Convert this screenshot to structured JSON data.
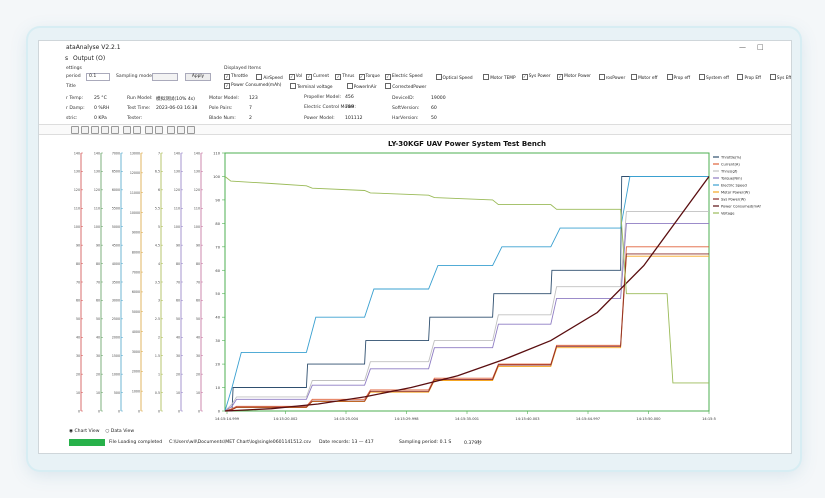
{
  "window": {
    "title": "ataAnalyse V2.2.1",
    "close_icon": "close-icon",
    "max_icon": "maximize-icon"
  },
  "menu": {
    "item1": "s",
    "item2": "Output (O)"
  },
  "settings": {
    "section": "ettings",
    "period_label": "period",
    "period_value": "0.1",
    "sampling_mode_label": "Sampling mode",
    "apply_label": "Apply",
    "title_label": "Title"
  },
  "displayed_items": {
    "header": "Displayed Items",
    "row1": [
      {
        "label": "Throttle",
        "checked": true
      },
      {
        "label": "AirSpeed",
        "checked": false
      },
      {
        "label": "Vol",
        "checked": true
      },
      {
        "label": "Current",
        "checked": true
      },
      {
        "label": "Thrus",
        "checked": true
      },
      {
        "label": "Torque",
        "checked": true
      },
      {
        "label": "Electric Speed",
        "checked": true
      },
      {
        "label": "Optical Speed",
        "checked": false
      },
      {
        "label": "Motor TEMP",
        "checked": false
      },
      {
        "label": "Sys Power",
        "checked": true
      },
      {
        "label": "Motor Power",
        "checked": true
      },
      {
        "label": "rosPower",
        "checked": false
      },
      {
        "label": "Motor eff",
        "checked": false
      },
      {
        "label": "Prop eff",
        "checked": false
      },
      {
        "label": "System eff",
        "checked": false
      },
      {
        "label": "Prop Eff",
        "checked": false
      },
      {
        "label": "Sys Eff",
        "checked": false
      }
    ],
    "row2": [
      {
        "label": "Power Consumed(mAh)",
        "checked": true
      },
      {
        "label": "Terminal voltage",
        "checked": false
      },
      {
        "label": "PowerInAir",
        "checked": false
      },
      {
        "label": "CorrectedPower",
        "checked": false
      }
    ]
  },
  "info": {
    "temp_label": "r Temp:",
    "temp_value": "25 °C",
    "damp_label": "r Damp:",
    "damp_value": "0 %RH",
    "atmos_label": "stric:",
    "atmos_value": "0 KPa",
    "run_model_label": "Run Model:",
    "run_model_value": "模拟测试(10% 4s)",
    "test_time_label": "Test Time:",
    "test_time_value": "2023-06-03 16:38",
    "tester_label": "Tester:",
    "tester_value": "",
    "motor_model_label": "Motor Model:",
    "motor_model_value": "123",
    "pole_pairs_label": "Pole Pairs:",
    "pole_pairs_value": "7",
    "blade_num_label": "Blade Num:",
    "blade_num_value": "2",
    "propeller_label": "Propeller Model:",
    "propeller_value": "456",
    "esc_label": "Electric Control Model:",
    "esc_value": "789",
    "power_model_label": "Power Model:",
    "power_model_value": "101112",
    "device_id_label": "DeviceID:",
    "device_id_value": "19000",
    "soft_label": "SoftVersion:",
    "soft_value": "60",
    "hard_label": "HarVersion:",
    "hard_value": "50"
  },
  "views": {
    "chart": "Chart View",
    "data": "Data View"
  },
  "status": {
    "file_loaded": "File Loading completed",
    "path": "C:\\Users\\wll\\Documents\\MET Chart\\log\\single0601141512.csv",
    "records": "Date records: 13 — 417",
    "period": "Sampling period: 0.1 S",
    "elapsed": "0.379秒",
    "progress": 1.0
  },
  "chart_data": {
    "type": "line",
    "title": "LY-30KGF UAV Power System Test Bench",
    "x_ticks": [
      "14:15:14.999",
      "14:15:20.002",
      "14:15:25.004",
      "14:15:29.998",
      "14:15:35.001",
      "14:15:40.003",
      "14:15:44.997",
      "14:15:50.000",
      "14:15:5"
    ],
    "xlim": [
      0,
      416
    ],
    "ylim": [
      0,
      110
    ],
    "y_ticks_main": [
      0,
      10,
      20,
      30,
      40,
      50,
      60,
      70,
      80,
      90,
      100,
      110
    ],
    "left_axes": [
      {
        "color": "#d04848",
        "ticks": [
          "0",
          "10",
          "20",
          "30",
          "40",
          "50",
          "60",
          "70",
          "80",
          "90",
          "100",
          "110",
          "120",
          "130",
          "140"
        ]
      },
      {
        "color": "#5b9b5b",
        "ticks": [
          "0",
          "10",
          "20",
          "30",
          "40",
          "50",
          "60",
          "70",
          "80",
          "90",
          "100",
          "110",
          "120",
          "130",
          "140"
        ]
      },
      {
        "color": "#4aa3c8",
        "ticks": [
          "0",
          "500",
          "1000",
          "1500",
          "2000",
          "2500",
          "3000",
          "3500",
          "4000",
          "4500",
          "5000",
          "5500",
          "6000",
          "6500",
          "7000"
        ]
      },
      {
        "color": "#d9a33a",
        "ticks": [
          "0",
          "1000",
          "2000",
          "3000",
          "4000",
          "5000",
          "6000",
          "7000",
          "8000",
          "9000",
          "10000",
          "11000",
          "12000",
          "13000"
        ]
      },
      {
        "color": "#a5b84a",
        "ticks": [
          "0",
          "0.5",
          "1",
          "1.5",
          "2",
          "2.5",
          "3",
          "3.5",
          "4",
          "4.5",
          "5",
          "5.5",
          "6",
          "6.5",
          "7"
        ]
      },
      {
        "color": "#8e7cc3",
        "ticks": [
          "0",
          "10",
          "20",
          "30",
          "40",
          "50",
          "60",
          "70",
          "80",
          "90",
          "100",
          "110",
          "120",
          "130",
          "140"
        ]
      },
      {
        "color": "#c06a9a",
        "ticks": [
          "0",
          "10",
          "20",
          "30",
          "40",
          "50",
          "60",
          "70",
          "80",
          "90",
          "100",
          "110",
          "120",
          "130",
          "140"
        ]
      }
    ],
    "legend_position": "right",
    "grid": false,
    "series": [
      {
        "name": "Throttle(%)",
        "color": "#2f4f6f",
        "x": [
          0,
          6,
          7,
          70,
          71,
          120,
          121,
          175,
          176,
          230,
          231,
          280,
          281,
          340,
          341,
          416
        ],
        "y": [
          0,
          0,
          10,
          10,
          20,
          20,
          30,
          30,
          40,
          40,
          50,
          50,
          60,
          60,
          100,
          100
        ]
      },
      {
        "name": "Current(A)",
        "color": "#e0623a",
        "x": [
          0,
          6,
          10,
          70,
          75,
          120,
          125,
          175,
          180,
          230,
          235,
          280,
          285,
          340,
          345,
          416
        ],
        "y": [
          0,
          1,
          2,
          2,
          5,
          5,
          9,
          9,
          14,
          14,
          20,
          20,
          28,
          28,
          70,
          70
        ]
      },
      {
        "name": "Thrus(gf)",
        "color": "#c0c0c0",
        "x": [
          0,
          6,
          10,
          70,
          75,
          120,
          125,
          175,
          180,
          230,
          235,
          280,
          285,
          340,
          345,
          416
        ],
        "y": [
          0,
          3,
          6,
          6,
          13,
          13,
          21,
          21,
          30,
          30,
          41,
          41,
          53,
          53,
          85,
          85
        ]
      },
      {
        "name": "Torque(Nm)",
        "color": "#8e7cc3",
        "x": [
          0,
          6,
          10,
          70,
          75,
          120,
          125,
          175,
          180,
          230,
          235,
          280,
          285,
          340,
          345,
          416
        ],
        "y": [
          0,
          2,
          5,
          5,
          11,
          11,
          18,
          18,
          27,
          27,
          37,
          37,
          48,
          48,
          80,
          80
        ]
      },
      {
        "name": "Electric Speed",
        "color": "#3aa0d0",
        "x": [
          0,
          6,
          14,
          70,
          78,
          120,
          128,
          175,
          183,
          230,
          238,
          280,
          288,
          340,
          348,
          416
        ],
        "y": [
          0,
          10,
          25,
          25,
          40,
          40,
          52,
          52,
          62,
          62,
          70,
          70,
          78,
          78,
          100,
          100
        ]
      },
      {
        "name": "Motor Power(W)",
        "color": "#f5a623",
        "x": [
          0,
          6,
          10,
          70,
          75,
          120,
          125,
          175,
          180,
          230,
          235,
          280,
          285,
          340,
          345,
          416
        ],
        "y": [
          0,
          0.5,
          1.5,
          1.5,
          4,
          4,
          8,
          8,
          13,
          13,
          19,
          19,
          27,
          27,
          66,
          66
        ]
      },
      {
        "name": "Sys Power(W)",
        "color": "#8b2c2c",
        "x": [
          0,
          6,
          10,
          70,
          75,
          120,
          125,
          175,
          180,
          230,
          235,
          280,
          285,
          340,
          345,
          416
        ],
        "y": [
          0,
          0.6,
          1.6,
          1.6,
          4.2,
          4.2,
          8.4,
          8.4,
          13.4,
          13.4,
          19.6,
          19.6,
          27.6,
          27.6,
          67,
          67
        ]
      },
      {
        "name": "Power Consumed(mAh)",
        "color": "#5a0e10",
        "x": [
          0,
          40,
          80,
          120,
          160,
          200,
          240,
          280,
          320,
          360,
          416
        ],
        "y": [
          0,
          1,
          3,
          6,
          10,
          15,
          22,
          30,
          42,
          62,
          100
        ]
      },
      {
        "name": "Voltage",
        "color": "#9bbb59",
        "x": [
          0,
          5,
          40,
          70,
          75,
          120,
          125,
          175,
          180,
          230,
          235,
          280,
          285,
          340,
          345,
          380,
          385,
          416
        ],
        "y": [
          100,
          98,
          97,
          96,
          95,
          94,
          93,
          92,
          91,
          90,
          88,
          88,
          86,
          86,
          50,
          50,
          12,
          12
        ]
      }
    ]
  }
}
